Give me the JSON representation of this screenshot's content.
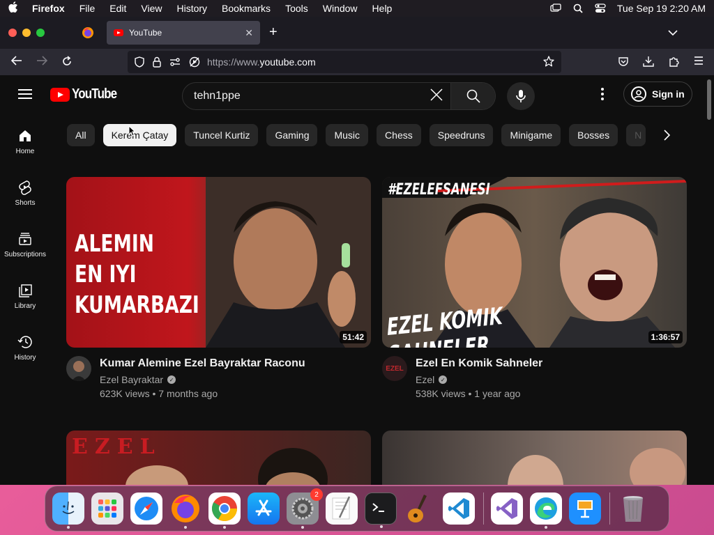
{
  "menubar": {
    "app_name": "Firefox",
    "items": [
      "File",
      "Edit",
      "View",
      "History",
      "Bookmarks",
      "Tools",
      "Window",
      "Help"
    ],
    "datetime": "Tue Sep 19  2:20 AM"
  },
  "browser": {
    "tab_title": "YouTube",
    "url_prefix": "https://www.",
    "url_host": "youtube.com"
  },
  "youtube": {
    "logo_text": "YouTube",
    "search_value": "tehn1ppe",
    "sign_in_label": "Sign in",
    "sidebar": [
      {
        "label": "Home"
      },
      {
        "label": "Shorts"
      },
      {
        "label": "Subscriptions"
      },
      {
        "label": "Library"
      },
      {
        "label": "History"
      }
    ],
    "chips": [
      "All",
      "Kerem Çatay",
      "Tuncel Kurtiz",
      "Gaming",
      "Music",
      "Chess",
      "Speedruns",
      "Minigame",
      "Bosses",
      "N"
    ],
    "active_chip": "Kerem Çatay",
    "videos": [
      {
        "title": "Kumar Alemine Ezel Bayraktar Raconu",
        "channel": "Ezel Bayraktar",
        "stats": "623K views • 7 months ago",
        "duration": "51:42",
        "thumb_lines": [
          "ALEMIN",
          "EN IYI",
          "KUMARBAZI"
        ]
      },
      {
        "title": "Ezel En Komik Sahneler",
        "channel": "Ezel",
        "stats": "538K views • 1 year ago",
        "duration": "1:36:57",
        "thumb_top": "#EZELEFSANESI",
        "thumb_bottom": "EZEL KOMIK SAHNELER"
      }
    ],
    "row2_thumb_text": "EZEL"
  },
  "dock": {
    "apps": [
      "Finder",
      "Launchpad",
      "Safari",
      "Firefox",
      "Chrome",
      "App Store",
      "System Settings",
      "TextEdit",
      "Terminal",
      "GarageBand",
      "VS Code",
      "Visual Studio",
      "Edge",
      "Keynote",
      "Trash"
    ],
    "settings_badge": "2"
  }
}
